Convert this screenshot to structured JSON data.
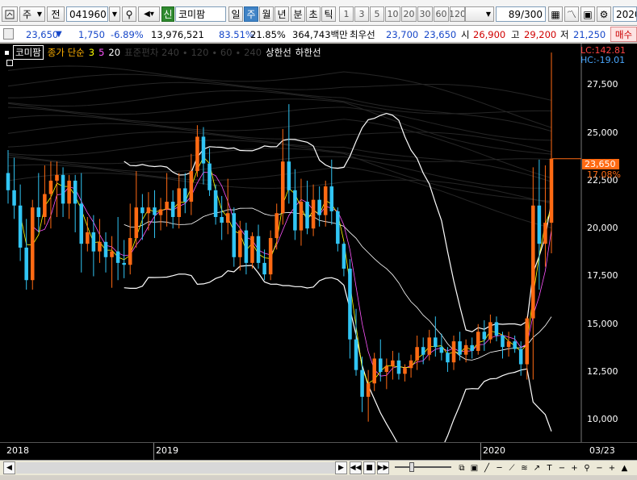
{
  "toolbar": {
    "market_select": "주",
    "type_select": "전",
    "code": "041960",
    "new_badge": "신",
    "name": "코미팜",
    "periods": [
      "일",
      "주",
      "월",
      "년",
      "분",
      "초",
      "틱"
    ],
    "active_period": "주",
    "numbers": [
      "1",
      "3",
      "5",
      "10",
      "20",
      "30",
      "60",
      "120"
    ],
    "count": "89",
    "count_total": "/300",
    "date": "2020/"
  },
  "quote": {
    "price": "23,650",
    "change_arrow": "▼",
    "change": "1,750",
    "change_pct": "-6.89%",
    "volume": "13,976,521",
    "ratio1": "83.51%",
    "ratio2": "21.85%",
    "amount": "364,743백만",
    "pref_label": "최우선",
    "pref1": "23,700",
    "pref2": "23,650",
    "open_label": "시",
    "open": "26,900",
    "high_label": "고",
    "high": "29,200",
    "low_label": "저",
    "low": "21,250",
    "buy_label": "매수"
  },
  "legend": {
    "name": "코미팜",
    "ma_label": "종가 단순",
    "ma3": "3",
    "ma5": "5",
    "ma20": "20",
    "faint": "표준편차 240 ∙ 120 ∙ 60 ∙ 240",
    "upper": "상한선",
    "lower": "하한선"
  },
  "yaxis": {
    "lc": "LC:142.81",
    "hc": "HC:-19.01",
    "current": "23,650",
    "current_pct": "17.08%",
    "labels": [
      "27,500",
      "25,000",
      "22,500",
      "20,000",
      "17,500",
      "15,000",
      "12,500",
      "10,000"
    ]
  },
  "xaxis": {
    "labels": [
      "2018",
      "2019",
      "2020",
      "03/23"
    ]
  },
  "colors": {
    "up": "#ff6a13",
    "down": "#31c5f4",
    "ma": "#ffff00",
    "band": "#ffffff",
    "bg": "#000000"
  },
  "chart_data": {
    "type": "candlestick",
    "ylim": [
      9000,
      29500
    ],
    "candles": [
      [
        22900,
        24100,
        21300,
        22000
      ],
      [
        22000,
        23700,
        20500,
        21200
      ],
      [
        21200,
        22300,
        18300,
        19000
      ],
      [
        19000,
        20500,
        16800,
        17300
      ],
      [
        17300,
        21500,
        16800,
        21100
      ],
      [
        21100,
        22900,
        19800,
        20600
      ],
      [
        20600,
        23300,
        20200,
        21800
      ],
      [
        21800,
        23500,
        20000,
        22500
      ],
      [
        22500,
        23500,
        20600,
        22800
      ],
      [
        22800,
        23200,
        20600,
        21300
      ],
      [
        21300,
        22800,
        20500,
        22500
      ],
      [
        22500,
        22800,
        19800,
        21300
      ],
      [
        21300,
        22900,
        17700,
        19200
      ],
      [
        19200,
        20600,
        18800,
        19800
      ],
      [
        19800,
        20700,
        17500,
        18800
      ],
      [
        18800,
        20500,
        18200,
        19300
      ],
      [
        19300,
        19800,
        17700,
        18500
      ],
      [
        18500,
        19600,
        16900,
        18800
      ],
      [
        18800,
        20600,
        17300,
        18200
      ],
      [
        18200,
        19400,
        17400,
        18100
      ],
      [
        18100,
        21300,
        17600,
        19500
      ],
      [
        19500,
        23000,
        19000,
        21100
      ],
      [
        21100,
        21800,
        19400,
        20800
      ],
      [
        20800,
        21900,
        19900,
        21100
      ],
      [
        21100,
        22000,
        19500,
        20700
      ],
      [
        20700,
        21600,
        19900,
        21000
      ],
      [
        21000,
        22900,
        20100,
        21400
      ],
      [
        21400,
        22000,
        20000,
        20600
      ],
      [
        20600,
        22900,
        20000,
        22100
      ],
      [
        22100,
        22900,
        20800,
        21400
      ],
      [
        21400,
        23900,
        20700,
        23000
      ],
      [
        23000,
        25400,
        22700,
        24800
      ],
      [
        24800,
        25300,
        22300,
        23400
      ],
      [
        23400,
        24200,
        21700,
        22000
      ],
      [
        22000,
        22300,
        20200,
        20600
      ],
      [
        20600,
        21700,
        19400,
        20300
      ],
      [
        20300,
        22600,
        19700,
        20800
      ],
      [
        20800,
        21100,
        18000,
        18500
      ],
      [
        18500,
        20400,
        17800,
        19900
      ],
      [
        19900,
        20300,
        17600,
        18200
      ],
      [
        18200,
        19800,
        17900,
        19600
      ],
      [
        19600,
        20200,
        17900,
        18200
      ],
      [
        18200,
        18900,
        17300,
        17600
      ],
      [
        17600,
        19900,
        17300,
        19500
      ],
      [
        19500,
        21300,
        18900,
        20800
      ],
      [
        20800,
        25200,
        20200,
        23500
      ],
      [
        23500,
        26500,
        21300,
        22000
      ],
      [
        22000,
        23100,
        19400,
        19900
      ],
      [
        19900,
        22600,
        19100,
        21400
      ],
      [
        21400,
        22500,
        19700,
        20000
      ],
      [
        20000,
        22300,
        19600,
        21500
      ],
      [
        21500,
        22200,
        20100,
        20700
      ],
      [
        20700,
        22500,
        20100,
        22200
      ],
      [
        22200,
        23600,
        20200,
        20900
      ],
      [
        20900,
        21100,
        18800,
        19200
      ],
      [
        19200,
        19300,
        17500,
        17900
      ],
      [
        17900,
        18400,
        13200,
        14200
      ],
      [
        14200,
        15800,
        12300,
        12600
      ],
      [
        12600,
        13300,
        10400,
        11200
      ],
      [
        11200,
        12600,
        9900,
        11900
      ],
      [
        11900,
        13500,
        11500,
        13200
      ],
      [
        13200,
        14200,
        12000,
        12500
      ],
      [
        12500,
        13200,
        11600,
        12800
      ],
      [
        12800,
        13600,
        12100,
        13100
      ],
      [
        13100,
        13500,
        12100,
        12400
      ],
      [
        12400,
        12900,
        12000,
        12700
      ],
      [
        12700,
        13400,
        12200,
        13100
      ],
      [
        13100,
        14400,
        12600,
        13800
      ],
      [
        13800,
        14300,
        12900,
        13400
      ],
      [
        13400,
        14700,
        13100,
        14300
      ],
      [
        14300,
        15400,
        13300,
        13800
      ],
      [
        13800,
        14500,
        13100,
        13500
      ],
      [
        13500,
        13800,
        12500,
        13000
      ],
      [
        13000,
        14400,
        12600,
        14100
      ],
      [
        14100,
        14600,
        13100,
        13400
      ],
      [
        13400,
        14200,
        13000,
        13900
      ],
      [
        13900,
        14300,
        13200,
        13600
      ],
      [
        13600,
        15000,
        13400,
        14600
      ],
      [
        14600,
        15200,
        13600,
        14200
      ],
      [
        14200,
        15500,
        14000,
        15100
      ],
      [
        15100,
        15400,
        14100,
        14400
      ],
      [
        14400,
        14600,
        13200,
        13800
      ],
      [
        13800,
        14600,
        13300,
        14100
      ],
      [
        14100,
        14400,
        13500,
        13700
      ],
      [
        13700,
        14100,
        12300,
        12900
      ],
      [
        12900,
        15400,
        12100,
        15300
      ],
      [
        15300,
        23200,
        12100,
        21200
      ],
      [
        21200,
        23600,
        16800,
        19200
      ],
      [
        19200,
        23300,
        18000,
        20300
      ],
      [
        20300,
        29200,
        18700,
        23650
      ]
    ]
  }
}
